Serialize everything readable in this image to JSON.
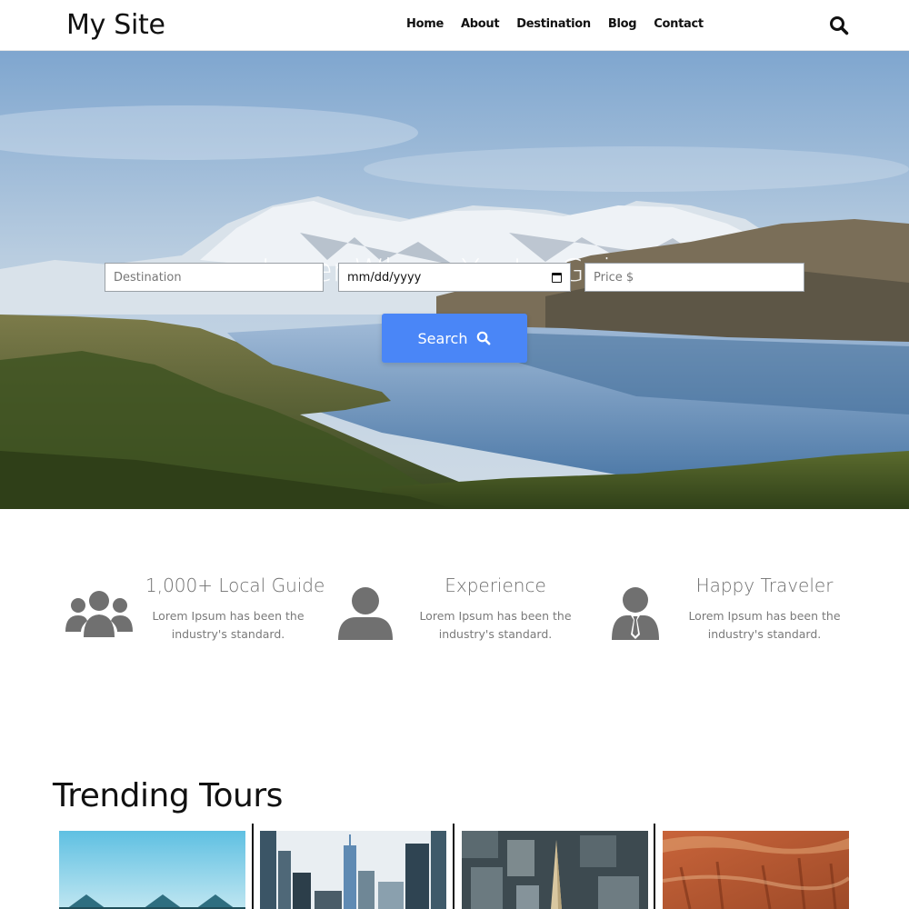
{
  "header": {
    "logo": "My Site",
    "nav": [
      "Home",
      "About",
      "Destination",
      "Blog",
      "Contact"
    ],
    "search_icon": "search-icon"
  },
  "hero": {
    "title": "Lover Where You're Going",
    "destination_placeholder": "Destination",
    "date_placeholder": "mm/dd/yyyy",
    "price_placeholder": "Price $",
    "search_label": "Search",
    "button_color": "#4a86f7"
  },
  "features": [
    {
      "icon": "users-icon",
      "title": "1,000+ Local Guide",
      "desc_line1": "Lorem Ipsum has been the",
      "desc_line2": "industry's standard."
    },
    {
      "icon": "user-icon",
      "title": "Experience",
      "desc_line1": "Lorem Ipsum has been the",
      "desc_line2": "industry's standard."
    },
    {
      "icon": "user-tie-icon",
      "title": "Happy Traveler",
      "desc_line1": "Lorem Ipsum has been the",
      "desc_line2": "industry's standard."
    }
  ],
  "trending": {
    "title": "Trending Tours"
  },
  "colors": {
    "icon_gray": "#707070",
    "accent": "#4a86f7"
  }
}
